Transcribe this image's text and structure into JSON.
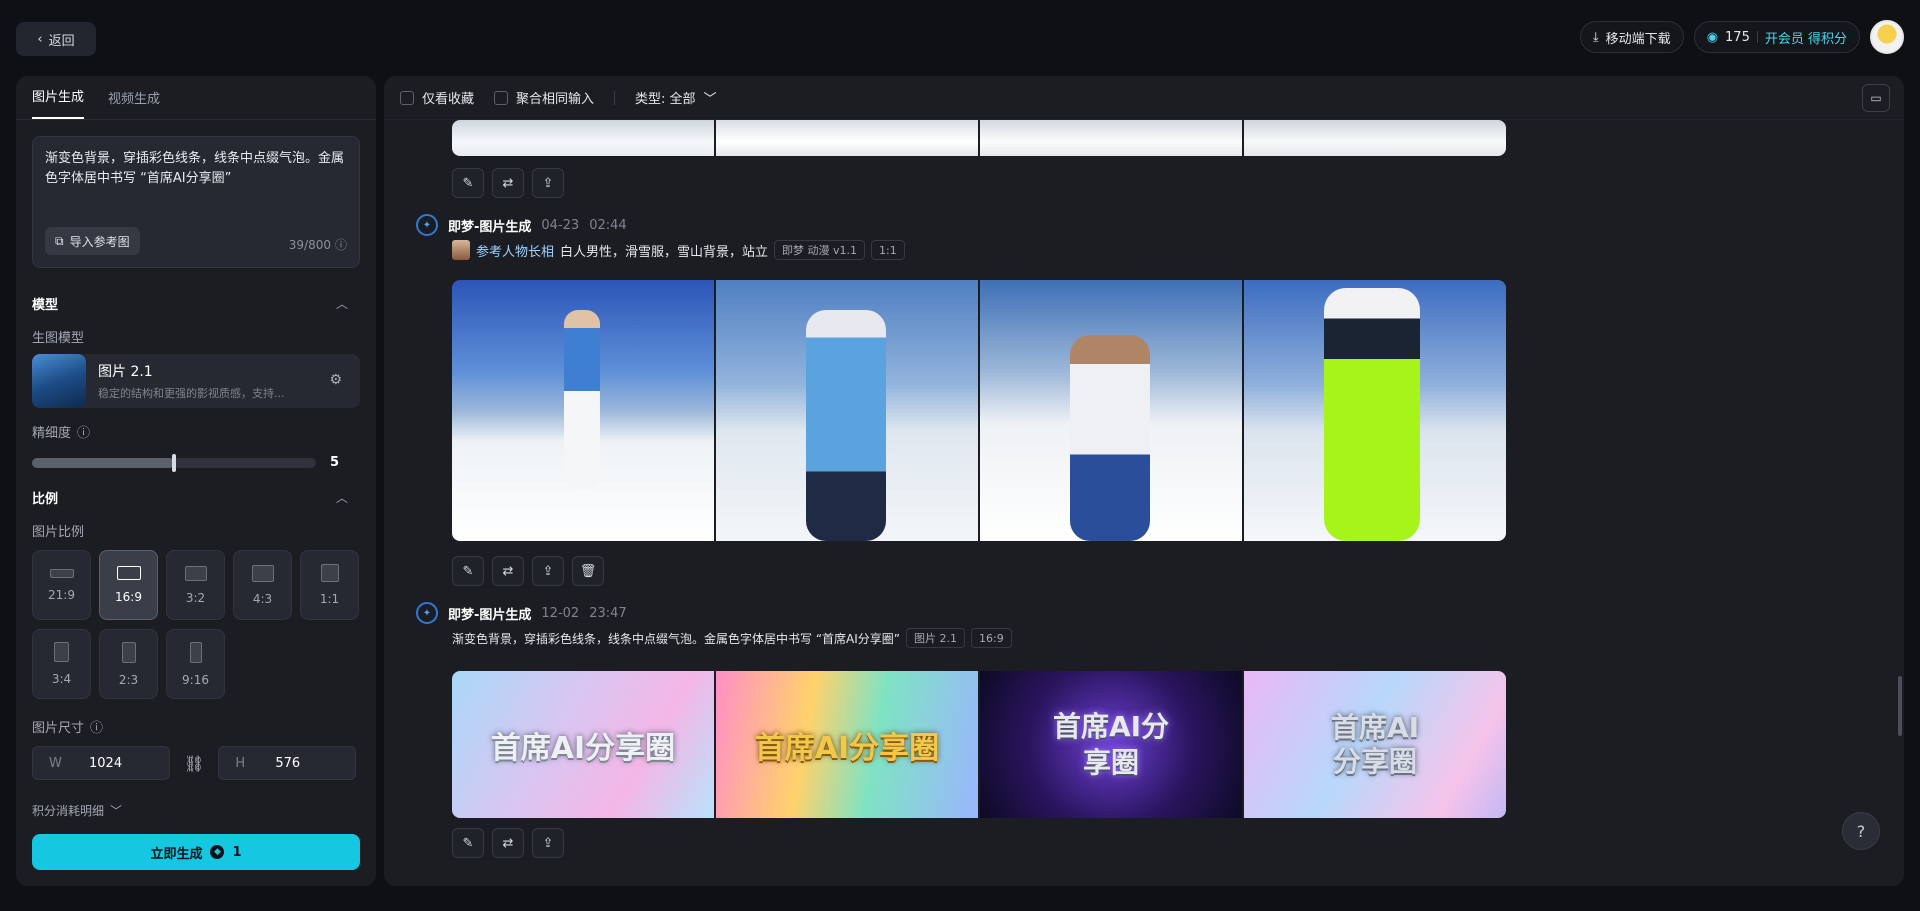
{
  "topbar": {
    "back_label": "返回",
    "mobile_download": "移动端下载",
    "points": "175",
    "vip_label": "开会员 得积分"
  },
  "sidebar": {
    "tabs": [
      {
        "label": "图片生成",
        "active": true
      },
      {
        "label": "视频生成",
        "active": false
      }
    ],
    "prompt": "渐变色背景，穿插彩色线条，线条中点缀气泡。金属色字体居中书写 “首席AI分享圈”",
    "import_ref_label": "导入参考图",
    "char_count": "39/800",
    "model_section": "模型",
    "model_sub": "生图模型",
    "model_name": "图片 2.1",
    "model_desc": "稳定的结构和更强的影视质感，支持...",
    "detail_label": "精细度",
    "detail_value": 5,
    "ratio_section": "比例",
    "ratio_sub": "图片比例",
    "ratios": [
      {
        "label": "21:9",
        "active": false
      },
      {
        "label": "16:9",
        "active": true
      },
      {
        "label": "3:2",
        "active": false
      },
      {
        "label": "4:3",
        "active": false
      },
      {
        "label": "1:1",
        "active": false
      },
      {
        "label": "3:4",
        "active": false
      },
      {
        "label": "2:3",
        "active": false
      },
      {
        "label": "9:16",
        "active": false
      }
    ],
    "size_label": "图片尺寸",
    "width_label": "W",
    "width_value": "1024",
    "height_label": "H",
    "height_value": "576",
    "cost_label": "积分消耗明细",
    "generate_label": "立即生成",
    "generate_cost": "1"
  },
  "filters": {
    "favorites_only": "仅看收藏",
    "merge_same": "聚合相同输入",
    "type_label": "类型: 全部"
  },
  "entries": [
    {
      "title": "即梦-图片生成",
      "date": "04-23",
      "time": "02:44",
      "ref_label": "参考人物长相",
      "prompt": "白人男性，滑雪服，雪山背景，站立",
      "tags": [
        "即梦 动漫 v1.1",
        "1:1"
      ]
    },
    {
      "title": "即梦-图片生成",
      "date": "12-02",
      "time": "23:47",
      "prompt": "渐变色背景，穿插彩色线条，线条中点缀气泡。金属色字体居中书写 “首席AI分享圈”",
      "tags": [
        "图片 2.1",
        "16:9"
      ],
      "image_text": [
        "首席AI分享圈",
        "首席AI分享圈",
        "首席AI分享圈",
        "首席AI分享圈"
      ]
    }
  ],
  "help_label": "?"
}
